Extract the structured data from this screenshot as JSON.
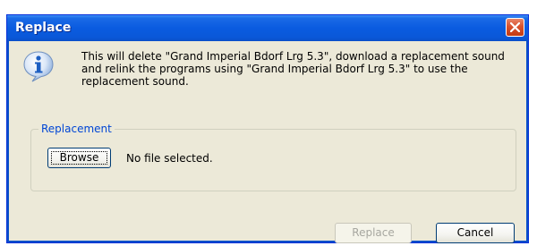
{
  "dialog": {
    "title": "Replace",
    "message": "This will delete \"Grand Imperial Bdorf Lrg 5.3\", download a replacement sound and relink the programs using \"Grand Imperial Bdorf Lrg 5.3\" to use the replacement sound.",
    "icon": "info-icon"
  },
  "replacement": {
    "group_label": "Replacement",
    "browse_label": "Browse",
    "file_status": "No file selected."
  },
  "buttons": {
    "replace_label": "Replace",
    "replace_enabled": false,
    "cancel_label": "Cancel"
  },
  "colors": {
    "titlebar": "#0a5be0",
    "group_label": "#0046d5",
    "close_button": "#d9522d"
  }
}
